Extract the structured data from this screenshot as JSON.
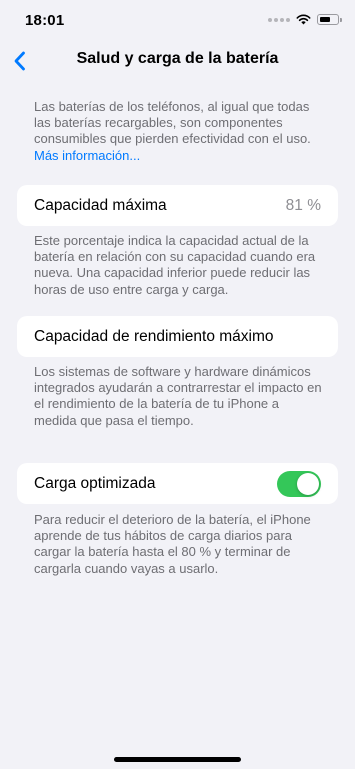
{
  "status_bar": {
    "time": "18:01",
    "icons": [
      "signal-icon",
      "wifi-icon",
      "battery-icon"
    ]
  },
  "nav": {
    "back_icon": "chevron-left-icon",
    "title": "Salud y carga de la batería",
    "accent": "#007aff"
  },
  "intro": {
    "text": "Las baterías de los teléfonos, al igual que todas las baterías recargables, son componentes consumibles que pierden efectividad con el uso.",
    "link": "Más información..."
  },
  "max_capacity": {
    "label": "Capacidad máxima",
    "value": "81 %",
    "footnote": "Este porcentaje indica la capacidad actual de la batería en relación con su capacidad cuando era nueva. Una capacidad inferior puede reducir las horas de uso entre carga y carga."
  },
  "peak_performance": {
    "label": "Capacidad de rendimiento máximo",
    "footnote": "Los sistemas de software y hardware dinámicos integrados ayudarán a contrarrestar el impacto en el rendimiento de la batería de tu iPhone a medida que pasa el tiempo."
  },
  "optimized_charging": {
    "label": "Carga optimizada",
    "enabled": true,
    "toggle_color": "#34c759",
    "footnote": "Para reducir el deterioro de la batería, el iPhone aprende de tus hábitos de carga diarios para cargar la batería hasta el 80 % y terminar de cargarla cuando vayas a usarlo."
  }
}
